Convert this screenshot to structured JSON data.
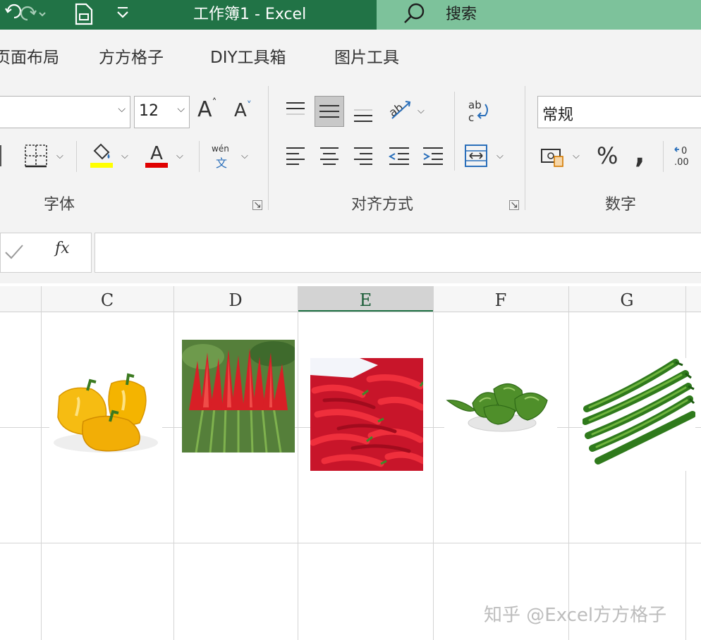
{
  "titlebar": {
    "title": "工作簿1  -  Excel",
    "search_label": "搜索",
    "undo_icon": "undo-icon",
    "redo_icon": "redo-icon",
    "customize_icon": "customize-quick-access-icon"
  },
  "tabs": [
    "页面布局",
    "方方格子",
    "DIY工具箱",
    "图片工具"
  ],
  "ribbon": {
    "font_size": "12",
    "number_format": "常规",
    "wen_label": "wén",
    "wen_char": "文",
    "groups": {
      "font": "字体",
      "alignment": "对齐方式",
      "number": "数字"
    },
    "colors": {
      "highlight": "#ffff00",
      "font_color": "#e00000"
    }
  },
  "formula_bar": {
    "fx": "fx",
    "value": ""
  },
  "grid": {
    "columns": [
      "C",
      "D",
      "E",
      "F",
      "G"
    ],
    "selected_column": "E"
  },
  "images": [
    {
      "column": "C",
      "subject": "yellow bell peppers"
    },
    {
      "column": "D",
      "subject": "red chili plant"
    },
    {
      "column": "E",
      "subject": "pile of red chilies"
    },
    {
      "column": "F",
      "subject": "green peppers on plate"
    },
    {
      "column": "G",
      "subject": "long green chilies"
    }
  ],
  "watermark": "知乎 @Excel方方格子"
}
